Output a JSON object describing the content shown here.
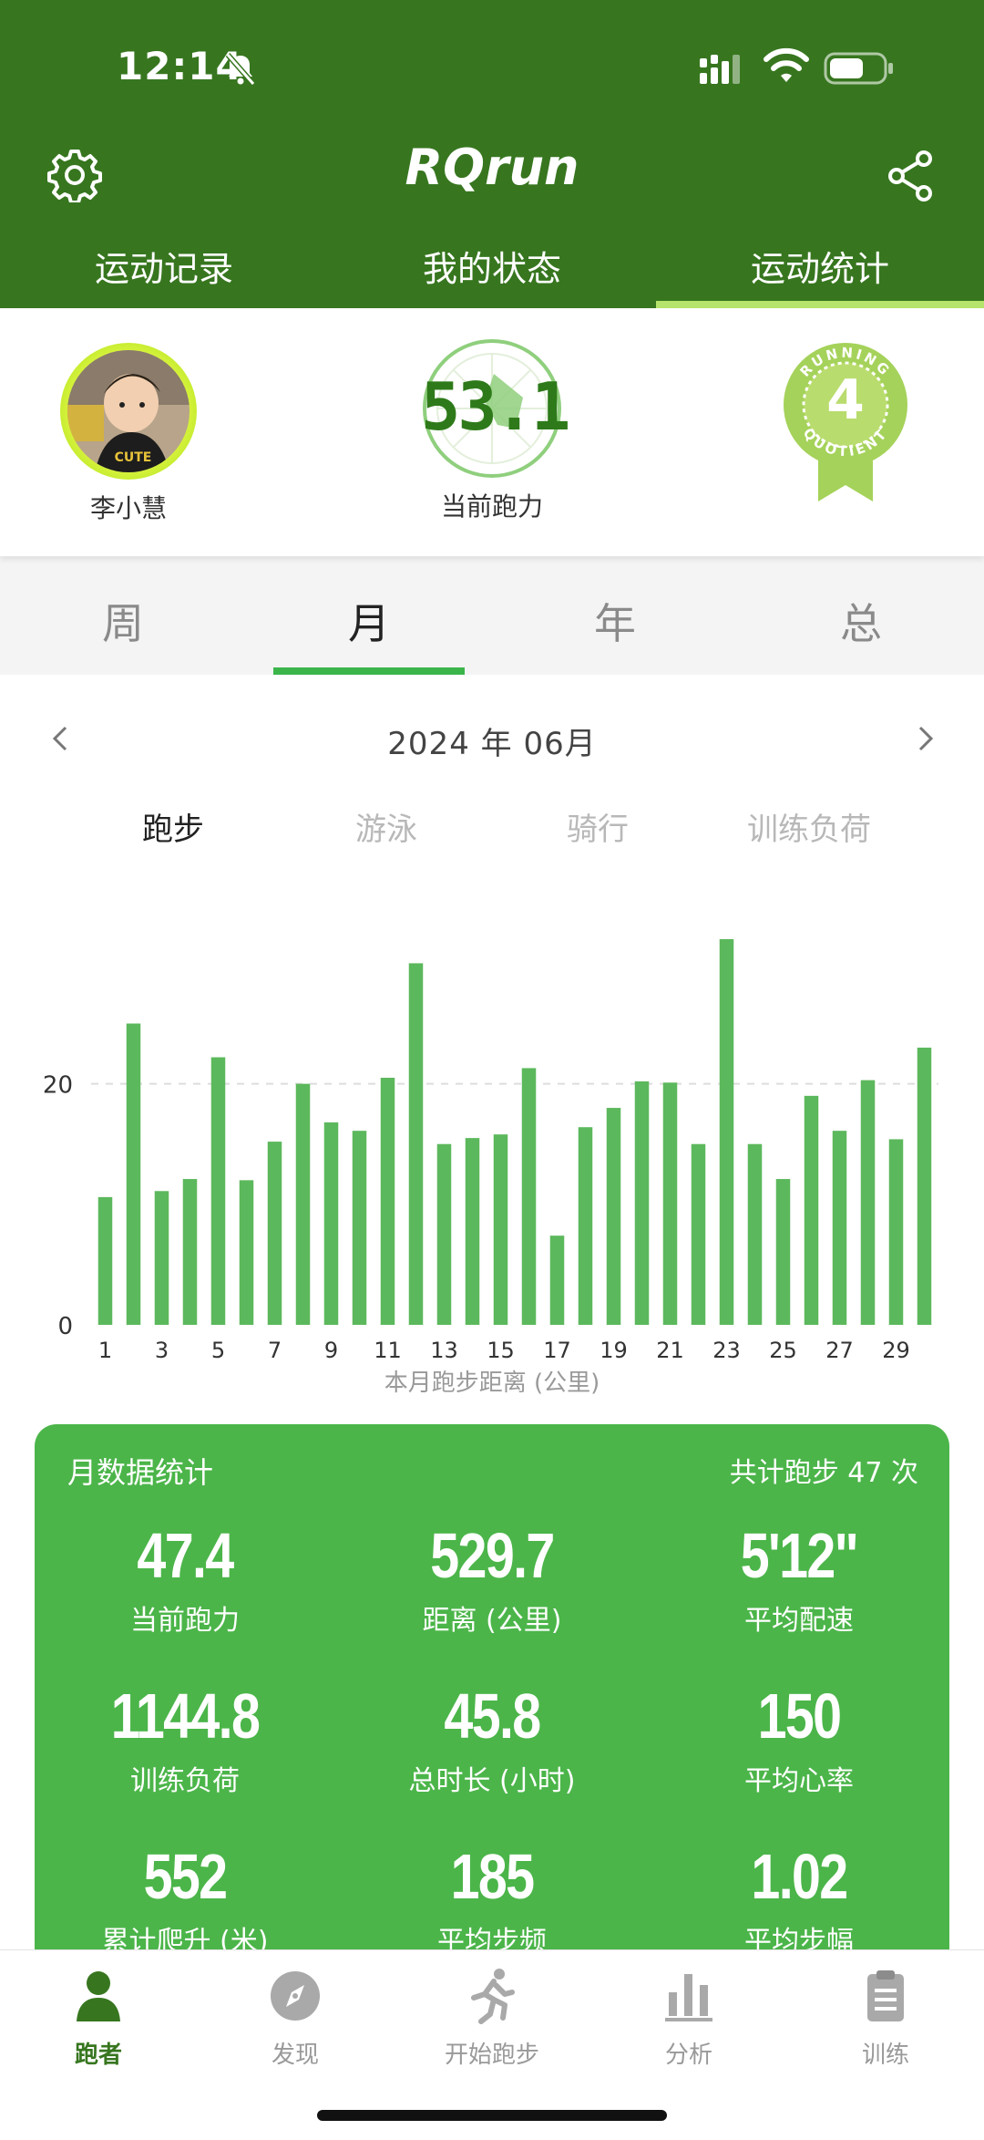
{
  "status_bar": {
    "time": "12:14"
  },
  "header": {
    "title": "RQrun",
    "tabs": [
      {
        "label": "运动记录",
        "active": false
      },
      {
        "label": "我的状态",
        "active": false
      },
      {
        "label": "运动统计",
        "active": true
      }
    ]
  },
  "profile": {
    "username": "李小慧",
    "running_power_value": "53.1",
    "running_power_label": "当前跑力",
    "badge": {
      "level": "4",
      "text": "RUNNING QUOTIENT"
    }
  },
  "period_tabs": [
    {
      "label": "周",
      "active": false
    },
    {
      "label": "月",
      "active": true
    },
    {
      "label": "年",
      "active": false
    },
    {
      "label": "总",
      "active": false
    }
  ],
  "month": "2024 年 06月",
  "sport_tabs": [
    {
      "label": "跑步",
      "active": true
    },
    {
      "label": "游泳",
      "active": false
    },
    {
      "label": "骑行",
      "active": false
    },
    {
      "label": "训练负荷",
      "active": false
    }
  ],
  "chart_data": {
    "type": "bar",
    "x": [
      1,
      2,
      3,
      4,
      5,
      6,
      7,
      8,
      9,
      10,
      11,
      12,
      13,
      14,
      15,
      16,
      17,
      18,
      19,
      20,
      21,
      22,
      23,
      24,
      25,
      26,
      27,
      28,
      29,
      30
    ],
    "x_tick_labels": [
      "1",
      "3",
      "5",
      "7",
      "9",
      "11",
      "13",
      "15",
      "17",
      "19",
      "21",
      "23",
      "25",
      "27",
      "29"
    ],
    "values": [
      10.6,
      25.0,
      11.1,
      12.1,
      22.2,
      12.0,
      15.2,
      20.0,
      16.8,
      16.1,
      20.5,
      30.0,
      15.0,
      15.5,
      15.8,
      21.3,
      7.4,
      16.4,
      18.0,
      20.2,
      20.1,
      15.0,
      32.0,
      15.0,
      12.1,
      19.0,
      16.1,
      20.3,
      15.4,
      23.0
    ],
    "y_tick_labels": [
      "0",
      "20"
    ],
    "ylim": [
      0,
      32
    ],
    "grid": "dashed at 20",
    "color": "#5cb85c",
    "caption": "本月跑步距离 (公里)"
  },
  "stats": {
    "title": "月数据统计",
    "total": "共计跑步 47 次",
    "items": [
      {
        "value": "47.4",
        "label": "当前跑力"
      },
      {
        "value": "529.7",
        "label": "距离 (公里)"
      },
      {
        "value": "5'12\"",
        "label": "平均配速"
      },
      {
        "value": "1144.8",
        "label": "训练负荷"
      },
      {
        "value": "45.8",
        "label": "总时长 (小时)"
      },
      {
        "value": "150",
        "label": "平均心率"
      },
      {
        "value": "552",
        "label": "累计爬升 (米)"
      },
      {
        "value": "185",
        "label": "平均步频"
      },
      {
        "value": "1.02",
        "label": "平均步幅"
      }
    ]
  },
  "bottom_nav": [
    {
      "label": "跑者",
      "icon": "person-icon",
      "active": true
    },
    {
      "label": "发现",
      "icon": "compass-icon",
      "active": false
    },
    {
      "label": "开始跑步",
      "icon": "runner-icon",
      "active": false
    },
    {
      "label": "分析",
      "icon": "bar-chart-icon",
      "active": false
    },
    {
      "label": "训练",
      "icon": "clipboard-icon",
      "active": false
    }
  ],
  "colors": {
    "header": "#37761f",
    "accent": "#3bb54a",
    "card": "#4bb549",
    "tab_underline": "#b5e36b"
  }
}
